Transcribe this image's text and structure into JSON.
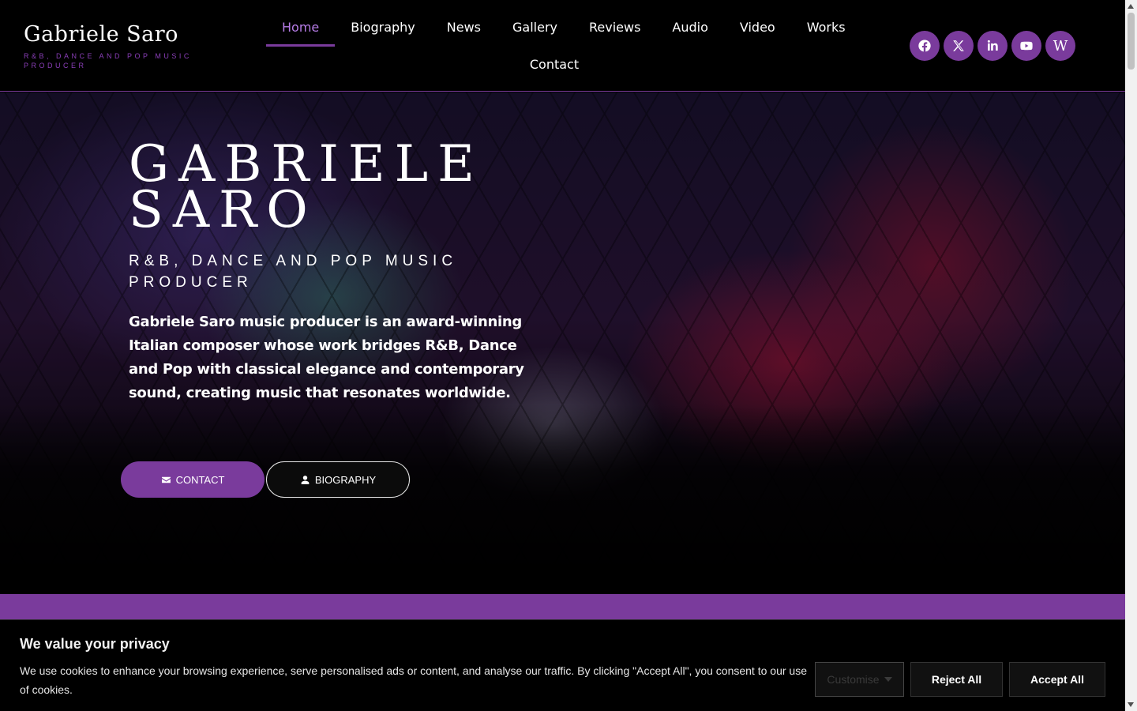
{
  "header": {
    "brand_name": "Gabriele Saro",
    "brand_tagline": "R&B, DANCE AND POP MUSIC PRODUCER",
    "nav": [
      "Home",
      "Biography",
      "News",
      "Gallery",
      "Reviews",
      "Audio",
      "Video",
      "Works",
      "Contact"
    ],
    "active_nav": "Home",
    "socials": [
      "facebook-icon",
      "x-icon",
      "linkedin-icon",
      "youtube-icon",
      "wikipedia-icon"
    ],
    "wikipedia_letter": "W"
  },
  "hero": {
    "title": "GABRIELE SARO",
    "subtitle": "R&B, DANCE AND POP MUSIC PRODUCER",
    "text": "Gabriele Saro music producer is an award-winning Italian composer whose work bridges R&B, Dance and Pop with classical elegance and contemporary sound, creating music that resonates worldwide.",
    "buttons": {
      "contact_label": "CONTACT",
      "biography_label": "BIOGRAPHY"
    }
  },
  "cookie": {
    "title": "We value your privacy",
    "text": "We use cookies to enhance your browsing experience, serve personalised ads or content, and analyse our traffic. By clicking \"Accept All\", you consent to our use of cookies.",
    "customise_label": "Customise",
    "reject_label": "Reject All",
    "accept_label": "Accept All"
  },
  "colors": {
    "accent": "#7a3b9c",
    "active_nav": "#b67ce6",
    "background": "#000000"
  }
}
